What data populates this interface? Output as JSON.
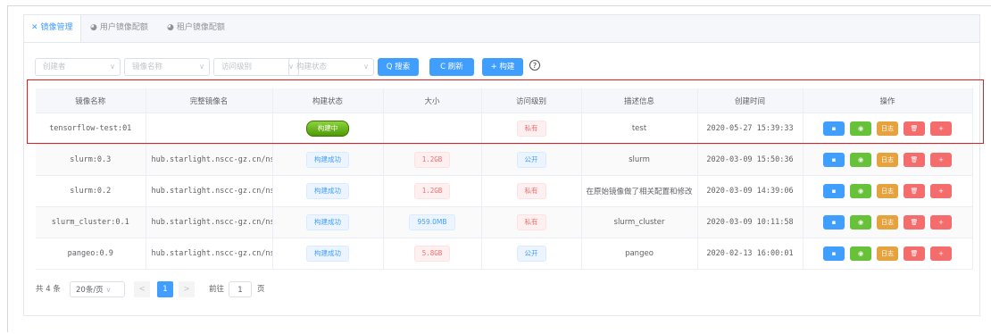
{
  "tabs": [
    {
      "icon": "✕",
      "label": "镜像管理"
    },
    {
      "icon": "◕",
      "label": "用户镜像配额"
    },
    {
      "icon": "◕",
      "label": "租户镜像配额"
    }
  ],
  "filters": {
    "creator_placeholder": "创建者",
    "image_name_placeholder": "镜像名称",
    "access_level_placeholder": "访问级别",
    "build_status_placeholder": "构建状态",
    "search_label": "Q 搜索",
    "refresh_label": "C 刷新",
    "build_label": "+ 构建",
    "help_icon": "?"
  },
  "table": {
    "headers": [
      "镜像名称",
      "完整镜像名",
      "构建状态",
      "大小",
      "访问级别",
      "描述信息",
      "创建时间",
      "操作"
    ],
    "rows": [
      {
        "name": "tensorflow-test:01",
        "full": "",
        "status": "构建中",
        "size": "",
        "access": "私有",
        "desc": "test",
        "time": "2020-05-27 15:39:33"
      },
      {
        "name": "slurm:0.3",
        "full": "hub.starlight.nscc-gz.cn/nsc",
        "status": "构建成功",
        "size": "1.2GB",
        "access": "公开",
        "desc": "slurm",
        "time": "2020-03-09 15:50:36"
      },
      {
        "name": "slurm:0.2",
        "full": "hub.starlight.nscc-gz.cn/nsc",
        "status": "构建成功",
        "size": "1.2GB",
        "access": "私有",
        "desc": "在原始镜像做了相关配置和修改",
        "time": "2020-03-09 14:39:06"
      },
      {
        "name": "slurm_cluster:0.1",
        "full": "hub.starlight.nscc-gz.cn/nsc",
        "status": "构建成功",
        "size": "959.0MB",
        "access": "私有",
        "desc": "slurm_cluster",
        "time": "2020-03-09 10:11:58"
      },
      {
        "name": "pangeo:0.9",
        "full": "hub.starlight.nscc-gz.cn/nsc",
        "status": "构建成功",
        "size": "5.8GB",
        "access": "公开",
        "desc": "pangeo",
        "time": "2020-02-13 16:00:01"
      }
    ],
    "ops": {
      "save": "▪",
      "view": "◉",
      "log": "日志",
      "delete": "🗑",
      "add": "+"
    }
  },
  "pagination": {
    "total": "共 4 条",
    "page_size": "20条/页",
    "prev": "<",
    "current": "1",
    "next": ">",
    "goto_prefix": "前往",
    "goto_value": "1",
    "goto_suffix": "页"
  },
  "colors": {
    "accent": "#409eff",
    "success": "#67c23a",
    "warning": "#e6a23c",
    "danger": "#f56c6c",
    "highlight": "#e02020"
  }
}
